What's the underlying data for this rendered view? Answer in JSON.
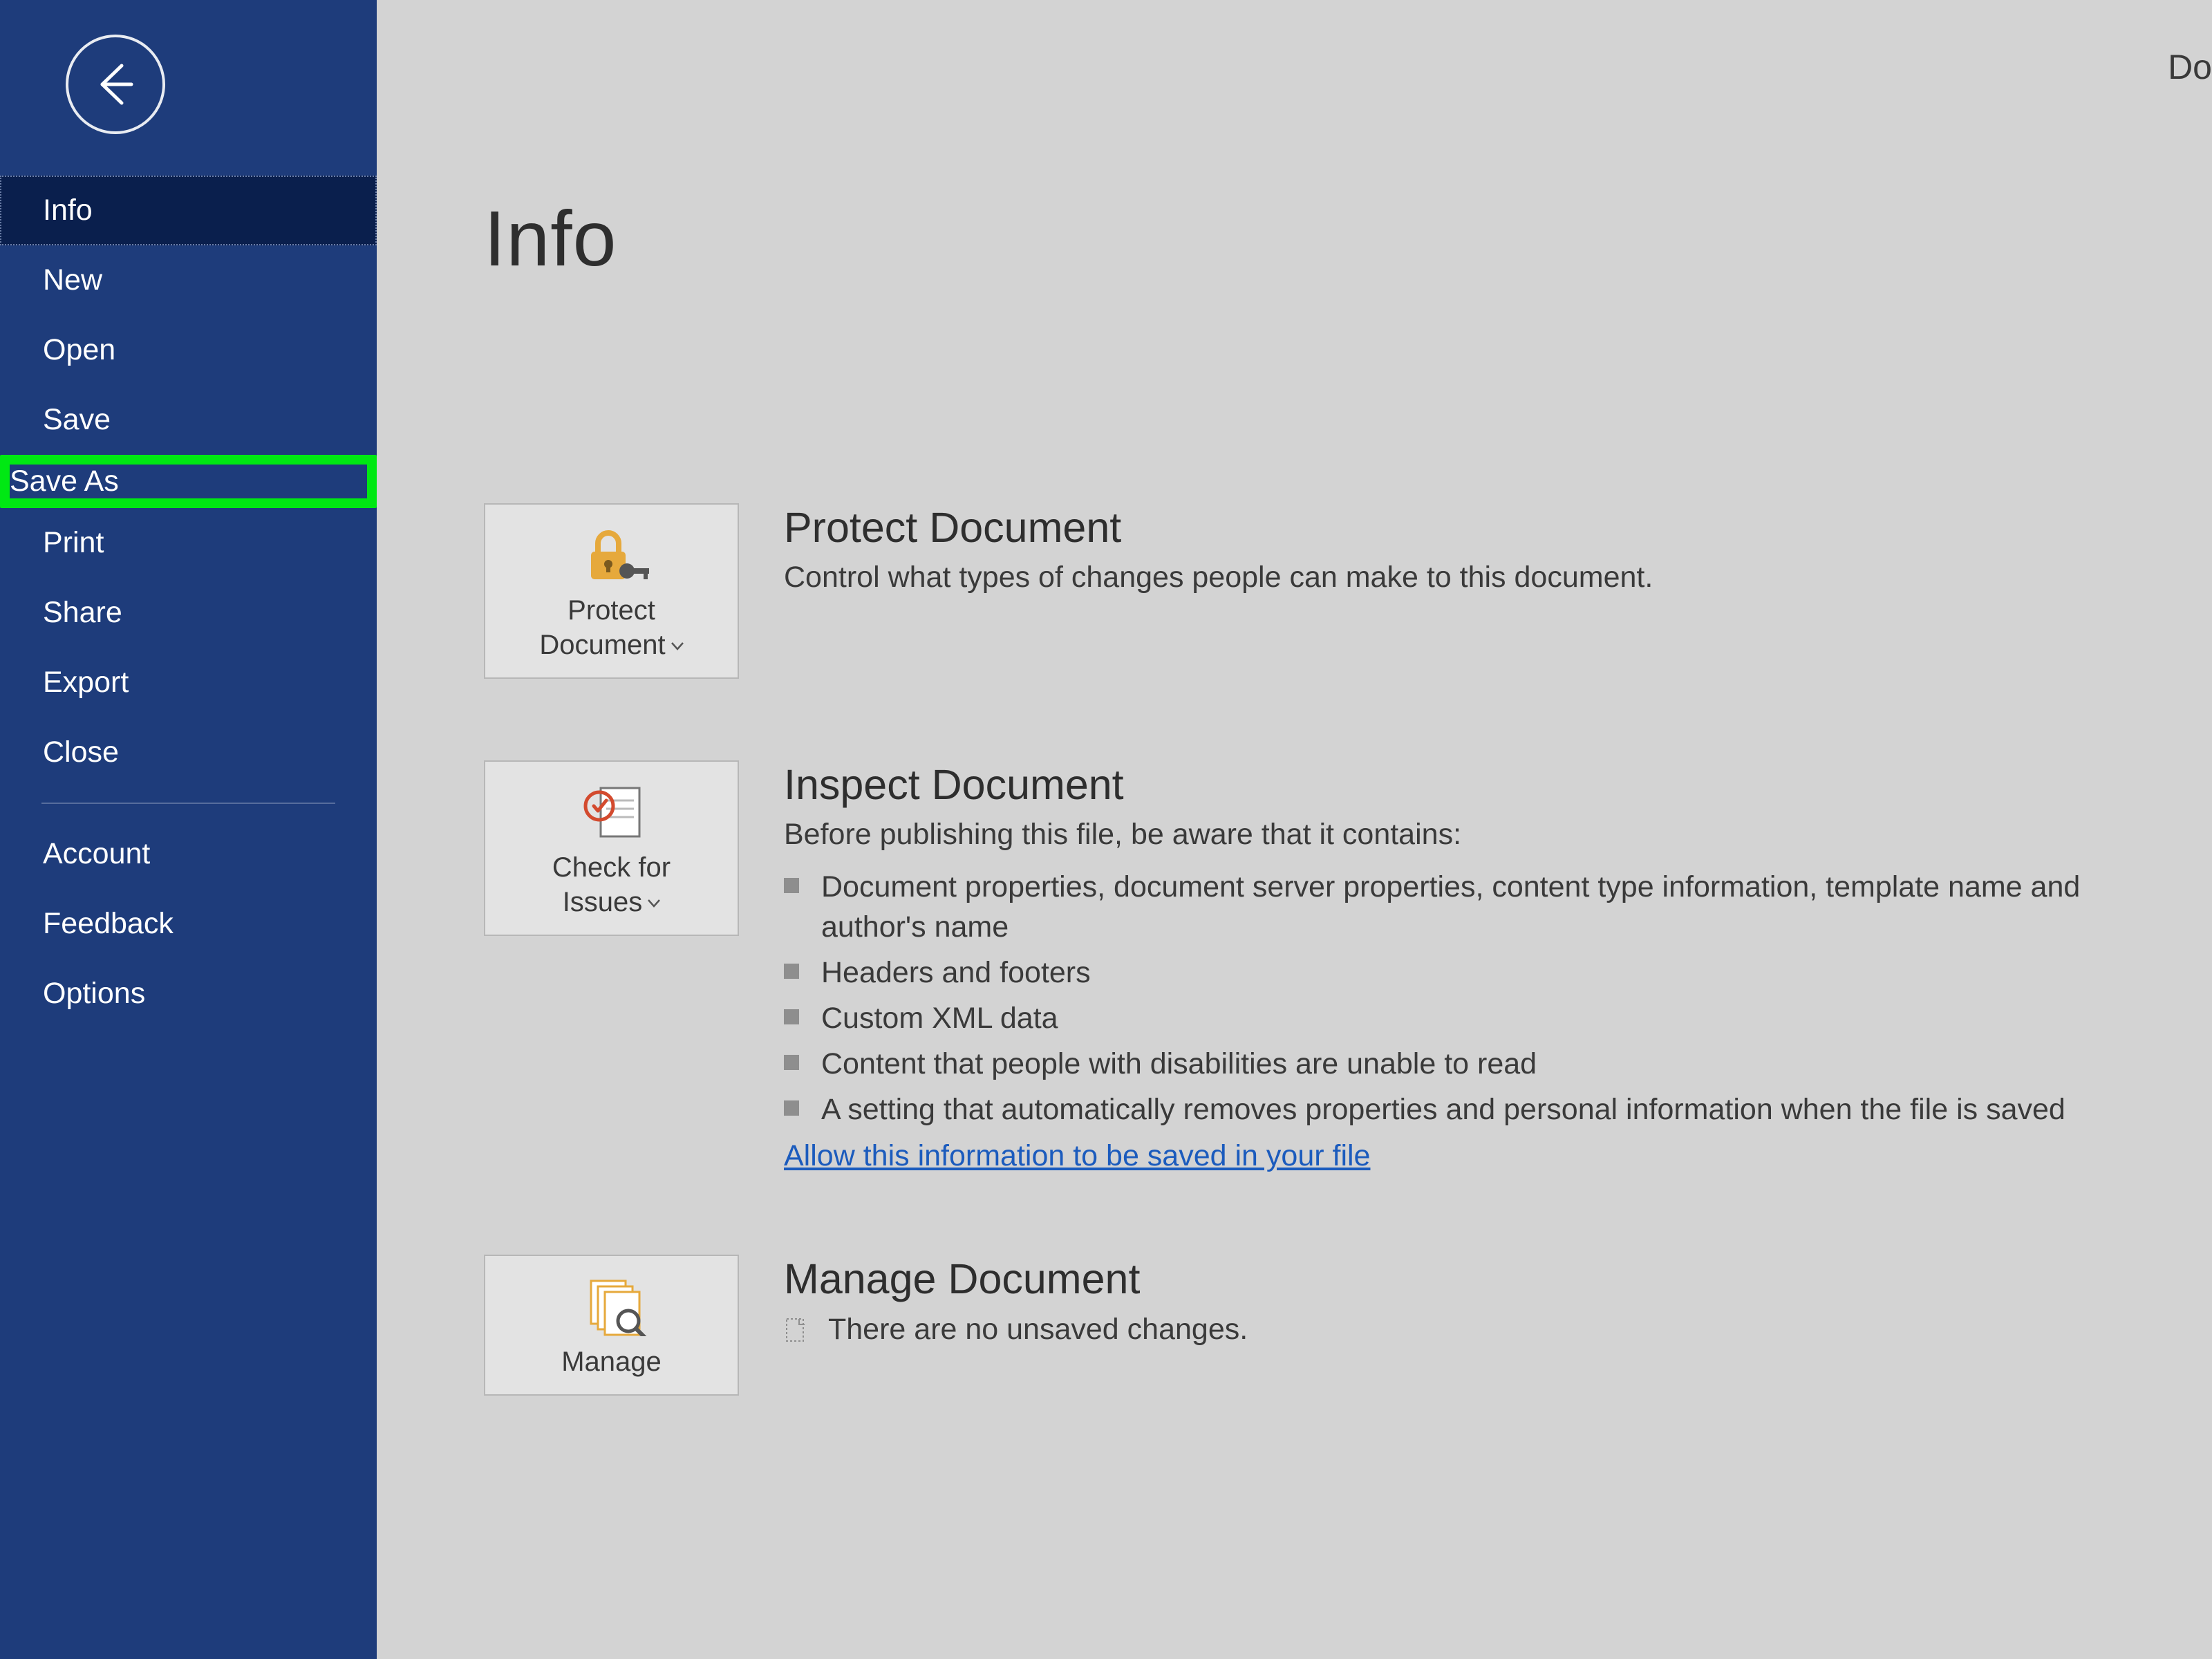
{
  "top_partial_text": "Do",
  "page_title": "Info",
  "sidebar": {
    "items": [
      {
        "label": "Info",
        "state": "selected"
      },
      {
        "label": "New"
      },
      {
        "label": "Open"
      },
      {
        "label": "Save"
      },
      {
        "label": "Save As",
        "state": "highlighted"
      },
      {
        "label": "Print"
      },
      {
        "label": "Share"
      },
      {
        "label": "Export"
      },
      {
        "label": "Close"
      }
    ],
    "footer_items": [
      {
        "label": "Account"
      },
      {
        "label": "Feedback"
      },
      {
        "label": "Options"
      }
    ]
  },
  "sections": {
    "protect": {
      "tile_line1": "Protect",
      "tile_line2": "Document",
      "title": "Protect Document",
      "desc": "Control what types of changes people can make to this document."
    },
    "inspect": {
      "tile_line1": "Check for",
      "tile_line2": "Issues",
      "title": "Inspect Document",
      "desc": "Before publishing this file, be aware that it contains:",
      "items": [
        "Document properties, document server properties, content type information, template name and author's name",
        "Headers and footers",
        "Custom XML data",
        "Content that people with disabilities are unable to read",
        "A setting that automatically removes properties and personal information when the file is saved"
      ],
      "link": "Allow this information to be saved in your file"
    },
    "manage": {
      "tile_line1": "Manage",
      "title": "Manage Document",
      "desc": "There are no unsaved changes."
    }
  }
}
